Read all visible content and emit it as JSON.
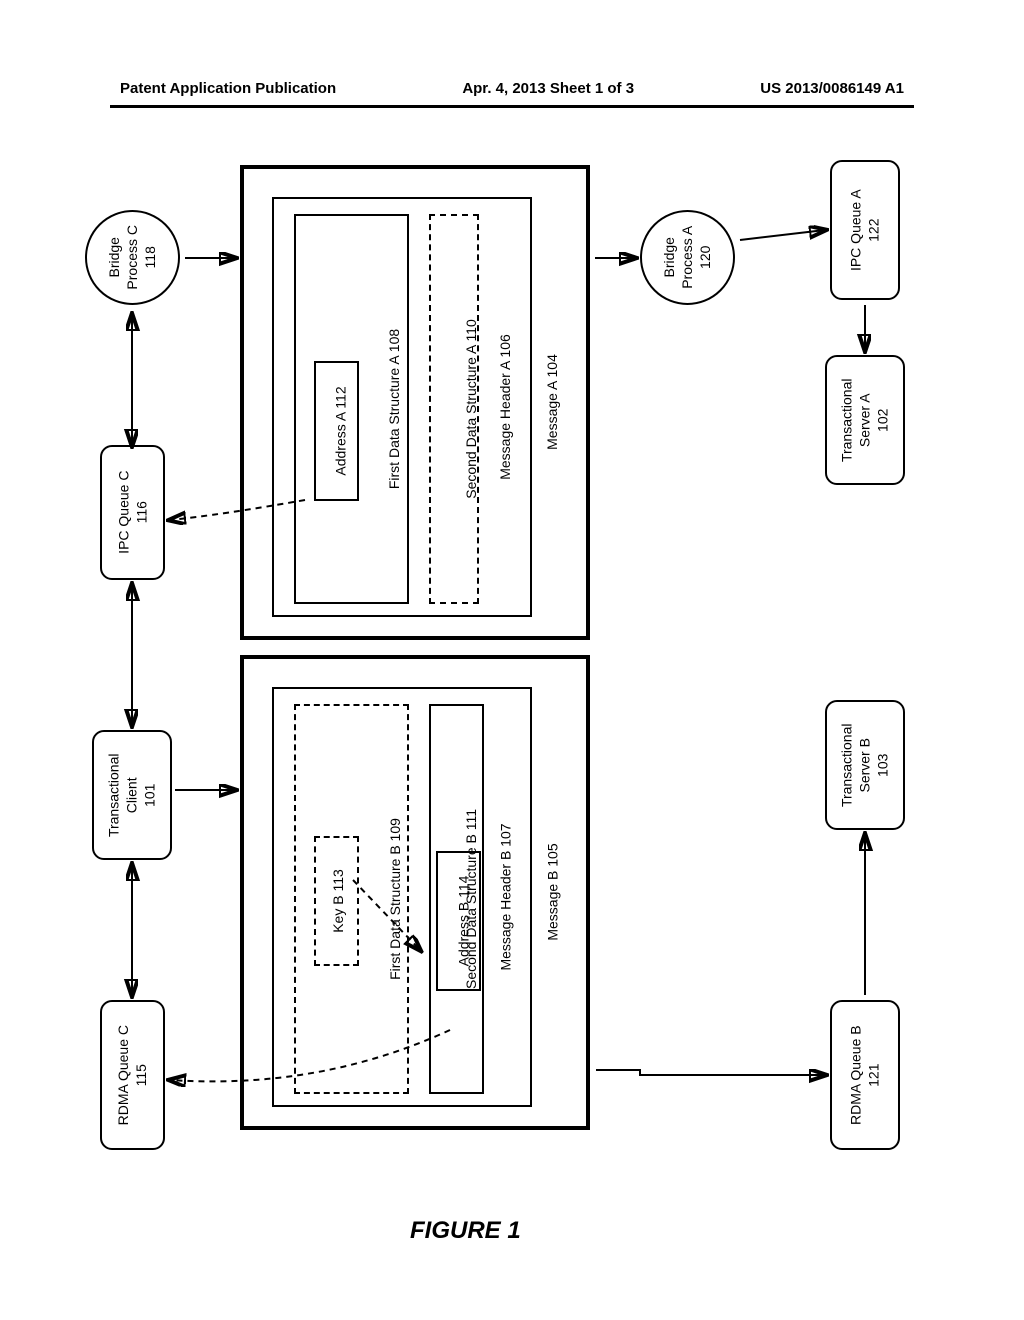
{
  "header": {
    "left": "Patent Application Publication",
    "center": "Apr. 4, 2013  Sheet 1 of 3",
    "right": "US 2013/0086149 A1"
  },
  "figure_label": "FIGURE 1",
  "nodes": {
    "bridge_c": "Bridge\nProcess C\n118",
    "ipc_queue_c": "IPC Queue C\n116",
    "trans_client": "Transactional\nClient\n101",
    "rdma_queue_c": "RDMA Queue C\n115",
    "bridge_a": "Bridge\nProcess A\n120",
    "ipc_queue_a": "IPC Queue A\n122",
    "trans_server_a": "Transactional\nServer A\n102",
    "trans_server_b": "Transactional\nServer B\n103",
    "rdma_queue_b": "RDMA Queue B\n121"
  },
  "messages": {
    "a": {
      "outer": "Message A 104",
      "header": "Message Header A 106",
      "first_ds": "First Data Structure A 108",
      "second_ds": "Second Data Structure A 110",
      "address": "Address A 112"
    },
    "b": {
      "outer": "Message B 105",
      "header": "Message Header B 107",
      "first_ds": "First Data Structure B 109",
      "second_ds": "Second Data Structure B 111",
      "key": "Key B 113",
      "address": "Address B 114"
    }
  }
}
